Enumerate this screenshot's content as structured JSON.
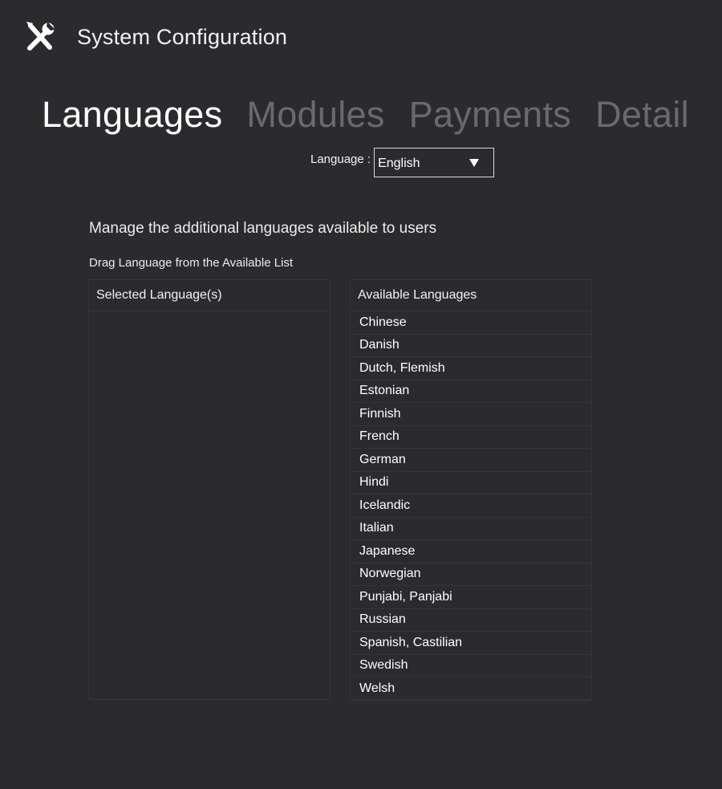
{
  "header": {
    "icon": "tools-icon",
    "title": "System Configuration"
  },
  "tabs": [
    {
      "label": "Languages",
      "active": true
    },
    {
      "label": "Modules",
      "active": false
    },
    {
      "label": "Payments",
      "active": false
    },
    {
      "label": "Detail",
      "active": false
    }
  ],
  "language_selector": {
    "label": "Language :",
    "value": "English"
  },
  "content": {
    "description": "Manage the additional languages available to users",
    "instruction": "Drag Language from the Available List"
  },
  "selected_list": {
    "header": "Selected Language(s)",
    "items": []
  },
  "available_list": {
    "header": "Available Languages",
    "items": [
      "Chinese",
      "Danish",
      "Dutch, Flemish",
      "Estonian",
      "Finnish",
      "French",
      "German",
      "Hindi",
      "Icelandic",
      "Italian",
      "Japanese",
      "Norwegian",
      "Punjabi, Panjabi",
      "Russian",
      "Spanish, Castilian",
      "Swedish",
      "Welsh"
    ]
  },
  "colors": {
    "background": "#2b2b2d",
    "text": "#ffffff",
    "inactive_tab": "#6a6a6c",
    "border": "#353537"
  }
}
